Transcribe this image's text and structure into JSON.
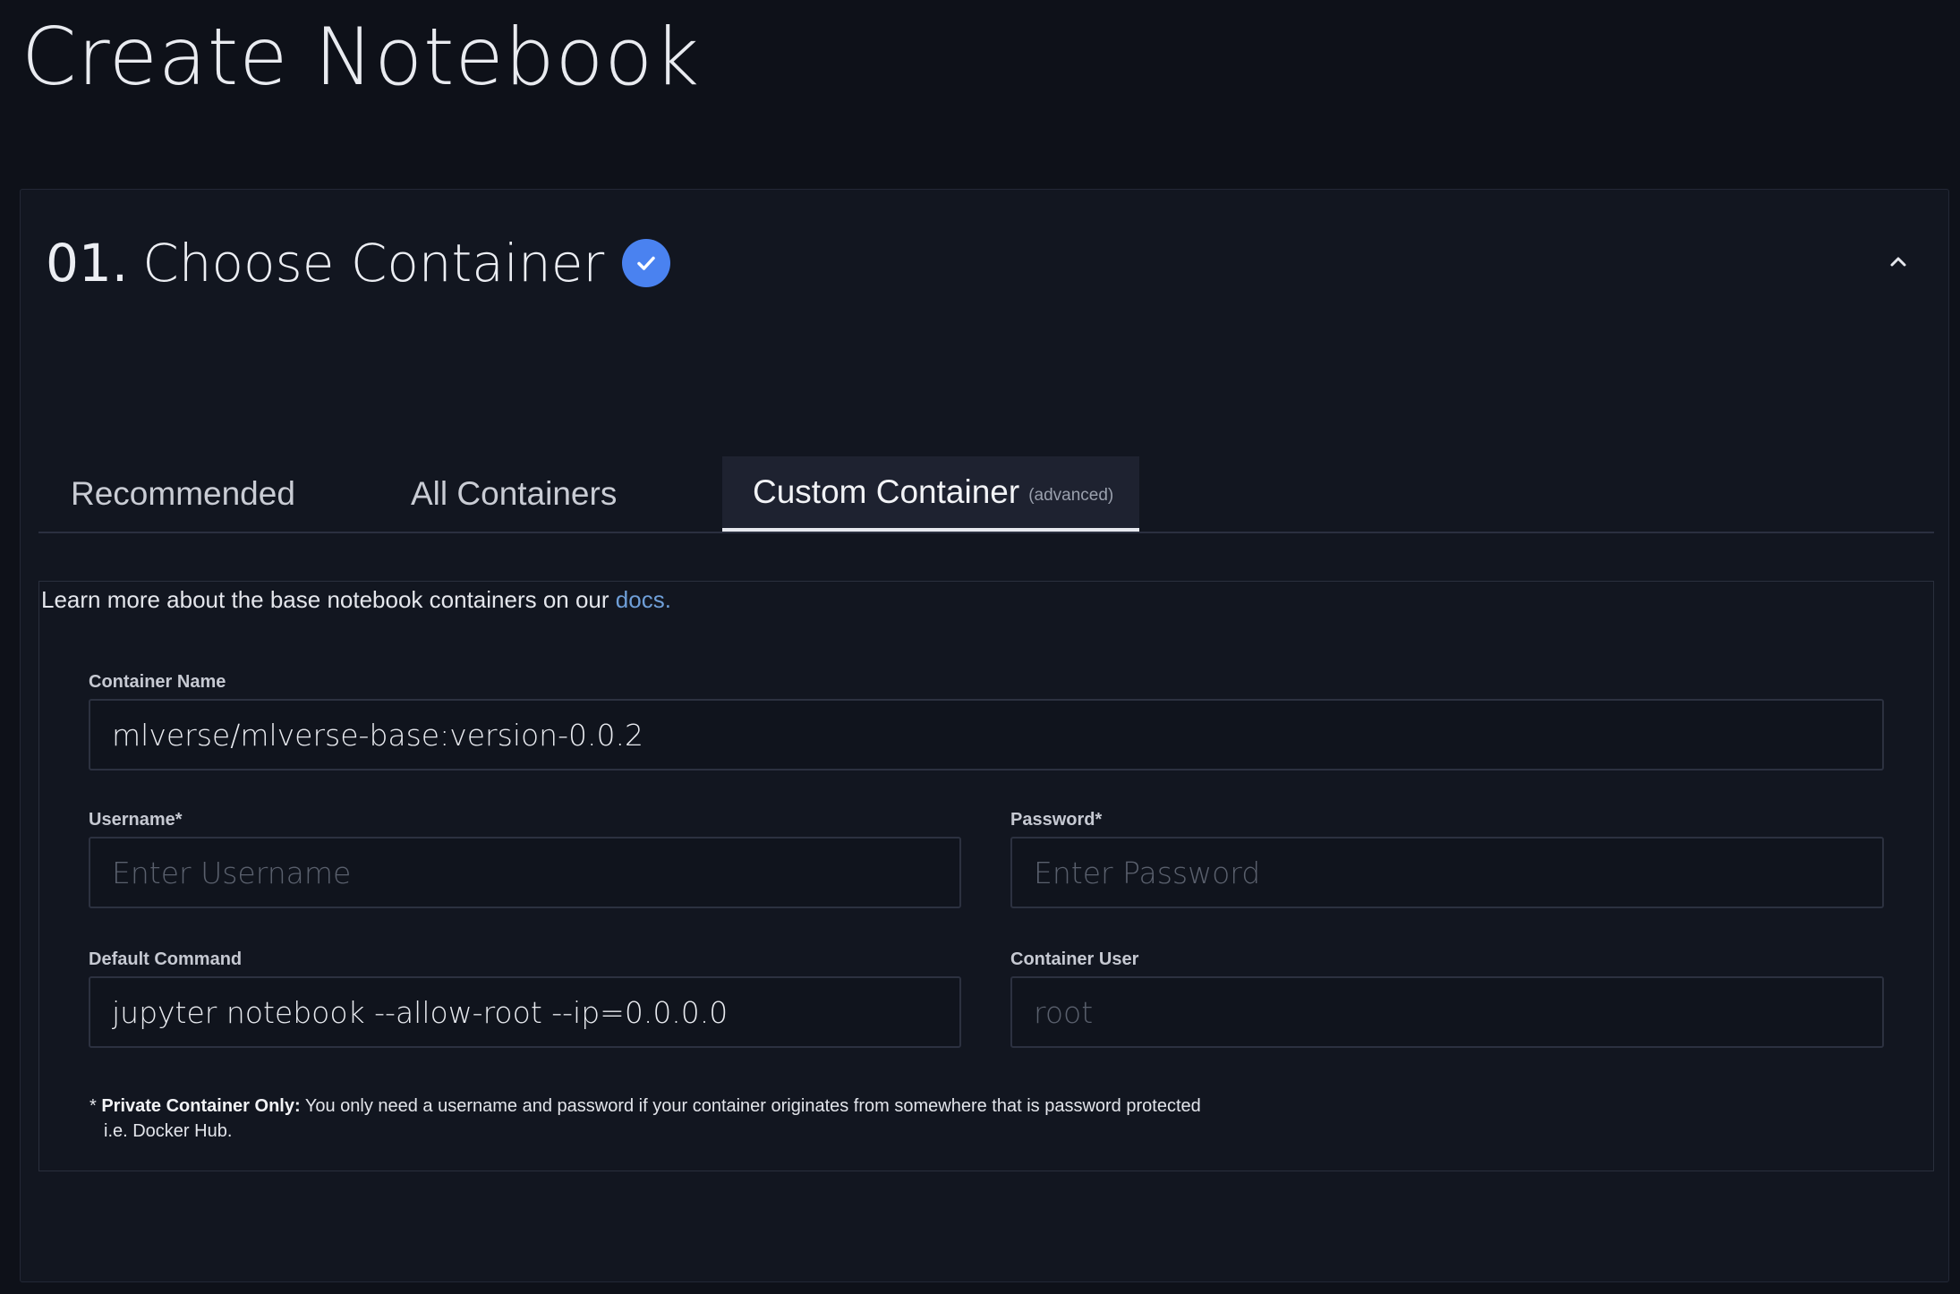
{
  "page": {
    "title": "Create Notebook"
  },
  "step": {
    "number": "01.",
    "title": "Choose Container",
    "completed_icon": "check-circle-icon",
    "collapse_icon": "chevron-up-icon"
  },
  "tabs": [
    {
      "label": "Recommended",
      "sub": "",
      "active": false
    },
    {
      "label": "All Containers",
      "sub": "",
      "active": false
    },
    {
      "label": "Custom Container",
      "sub": "(advanced)",
      "active": true
    }
  ],
  "intro": {
    "text": "Learn more about the base notebook containers on our ",
    "link": "docs."
  },
  "form": {
    "container_name": {
      "label": "Container Name",
      "value": "mlverse/mlverse-base:version-0.0.2",
      "placeholder": ""
    },
    "username": {
      "label": "Username*",
      "value": "",
      "placeholder": "Enter Username"
    },
    "password": {
      "label": "Password*",
      "value": "",
      "placeholder": "Enter Password"
    },
    "default_command": {
      "label": "Default Command",
      "value": "jupyter notebook --allow-root --ip=0.0.0.0",
      "placeholder": ""
    },
    "container_user": {
      "label": "Container User",
      "value": "",
      "placeholder": "root"
    }
  },
  "footnote": {
    "prefix": "* ",
    "bold": "Private Container Only:",
    "text": " You only need a username and password if your container originates from somewhere that is password protected",
    "line2": "i.e. Docker Hub."
  },
  "colors": {
    "background": "#0e1119",
    "panel": "#121620",
    "accent": "#4a82f0",
    "link": "#6f9fd8"
  }
}
